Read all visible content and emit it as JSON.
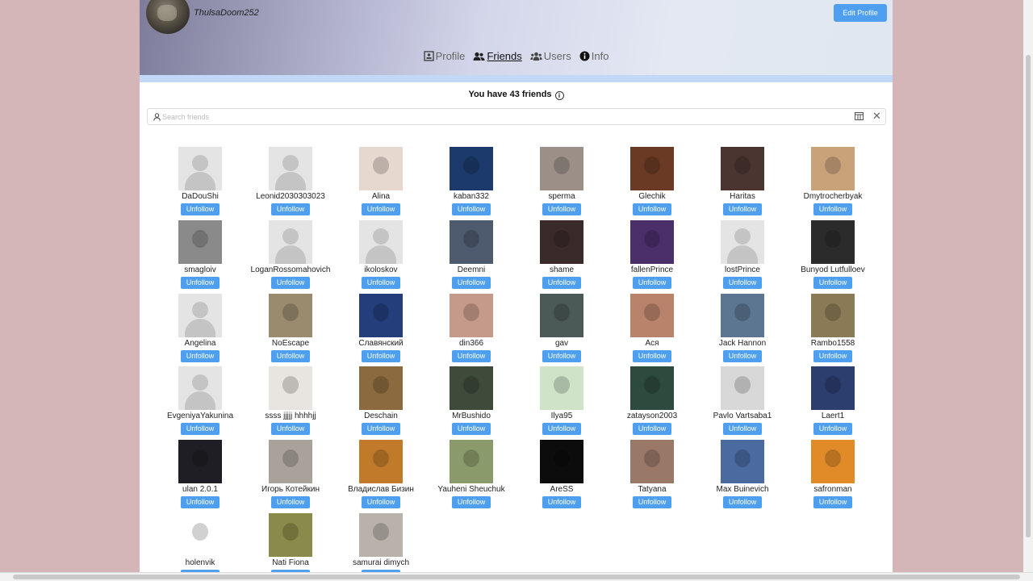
{
  "header": {
    "username": "ThulsaDoom252",
    "edit_button": "Edit Profile"
  },
  "nav": [
    {
      "label": "Profile",
      "icon": "profile-icon",
      "active": false
    },
    {
      "label": "Friends",
      "icon": "users-icon",
      "active": true
    },
    {
      "label": "Users",
      "icon": "users-group-icon",
      "active": false
    },
    {
      "label": "Info",
      "icon": "info-icon",
      "active": false
    }
  ],
  "friends": {
    "count_label": "You have 43 friends",
    "search_placeholder": "Search friends",
    "unfollow_label": "Unfollow",
    "list": [
      {
        "name": "DaDouShi",
        "avatar": "default"
      },
      {
        "name": "Leonid2030303023",
        "avatar": "default"
      },
      {
        "name": "Alina",
        "avatar": "#e6d7cf"
      },
      {
        "name": "kaban332",
        "avatar": "#1c3a6b"
      },
      {
        "name": "sperma",
        "avatar": "#9c8f88"
      },
      {
        "name": "Glechik",
        "avatar": "#6b3a24"
      },
      {
        "name": "Haritas",
        "avatar": "#4a3530"
      },
      {
        "name": "Dmytrocherbyak",
        "avatar": "#c9a27a"
      },
      {
        "name": "smagloiv",
        "avatar": "#8a8a8a"
      },
      {
        "name": "LoganRossomahovich",
        "avatar": "default"
      },
      {
        "name": "ikoloskov",
        "avatar": "default"
      },
      {
        "name": "Deemni",
        "avatar": "#4e5a6e"
      },
      {
        "name": "shame",
        "avatar": "#3b2a2a"
      },
      {
        "name": "fallenPrince",
        "avatar": "#4b2f6b"
      },
      {
        "name": "lostPrince",
        "avatar": "default"
      },
      {
        "name": "Bunyod Lutfulloev",
        "avatar": "#2b2b2b"
      },
      {
        "name": "Angelina",
        "avatar": "default"
      },
      {
        "name": "NoEscape",
        "avatar": "#9a8a6e"
      },
      {
        "name": "Славянский",
        "avatar": "#233e7a"
      },
      {
        "name": "din366",
        "avatar": "#c69a8a"
      },
      {
        "name": "gav",
        "avatar": "#4b5a56"
      },
      {
        "name": "Ася",
        "avatar": "#b8826b"
      },
      {
        "name": "Jack Hannon",
        "avatar": "#5c7590"
      },
      {
        "name": "Rambo1558",
        "avatar": "#8a7a56"
      },
      {
        "name": "EvgeniyaYakunina",
        "avatar": "default"
      },
      {
        "name": "ssss jjjjj hhhhjj",
        "avatar": "#e8e4e0"
      },
      {
        "name": "Deschain",
        "avatar": "#8a6a3e"
      },
      {
        "name": "MrBushido",
        "avatar": "#3e4a3a"
      },
      {
        "name": "Ilya95",
        "avatar": "#cfe3c8"
      },
      {
        "name": "zatayson2003",
        "avatar": "#2c4a3e"
      },
      {
        "name": "Pavlo Vartsaba1",
        "avatar": "#d8d8d8"
      },
      {
        "name": "Laert1",
        "avatar": "#2c3e6e"
      },
      {
        "name": "ulan 2.0.1",
        "avatar": "#1e1e24"
      },
      {
        "name": "Игорь Котейкин",
        "avatar": "#a8a29a"
      },
      {
        "name": "Владислав Бизин",
        "avatar": "#c07a2a"
      },
      {
        "name": "Yauheni Sheuchuk",
        "avatar": "#8a9a6a"
      },
      {
        "name": "AreSS",
        "avatar": "#0c0c0c"
      },
      {
        "name": "Tatyana",
        "avatar": "#9a7868"
      },
      {
        "name": "Max Buinevich",
        "avatar": "#4a6aa0"
      },
      {
        "name": "safronman",
        "avatar": "#e08a28"
      },
      {
        "name": "holenvik",
        "avatar": "#ffffff"
      },
      {
        "name": "Nati Fiona",
        "avatar": "#8a8a4a"
      },
      {
        "name": "samurai dimych",
        "avatar": "#b8b2aa"
      }
    ]
  }
}
